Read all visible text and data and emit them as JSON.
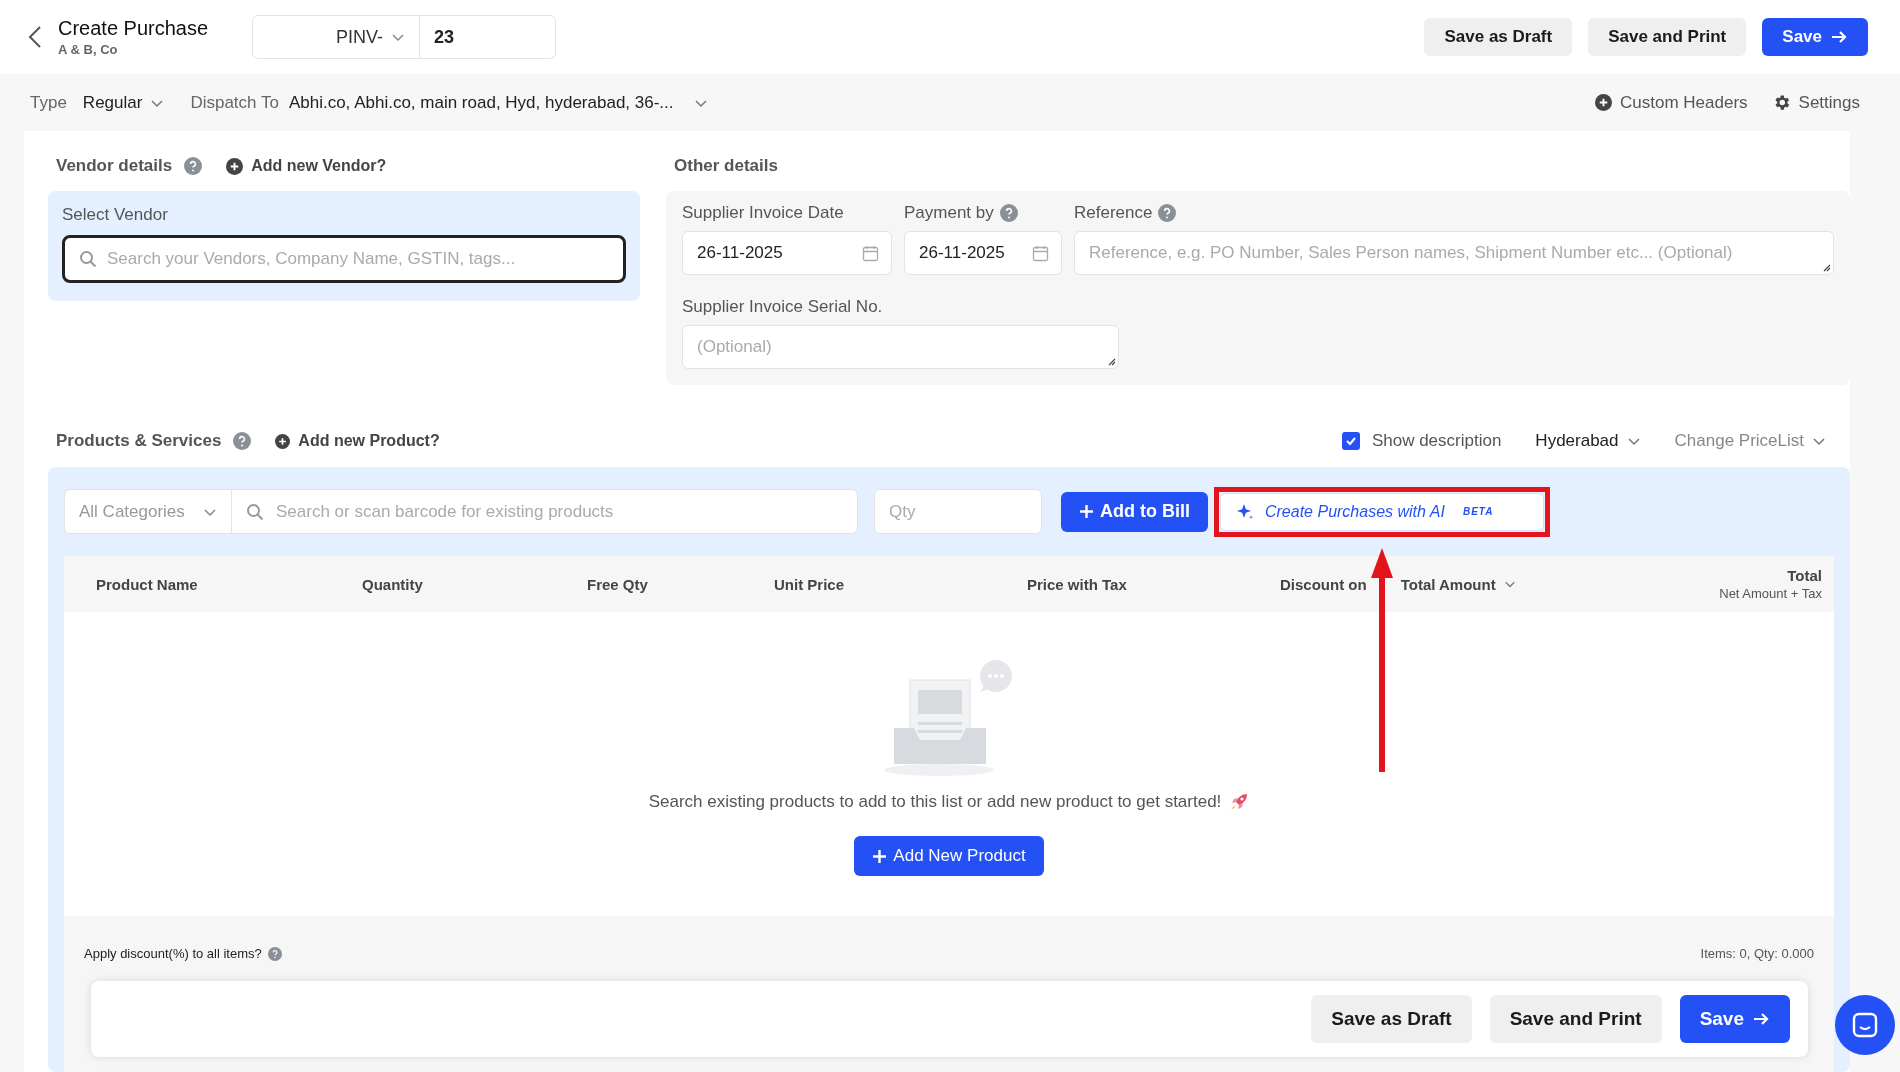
{
  "header": {
    "title": "Create Purchase",
    "subtitle": "A & B, Co",
    "prefix": "PINV-",
    "number": "23",
    "buttons": [
      {
        "label": "Save as Draft",
        "kind": "secondary"
      },
      {
        "label": "Save and Print",
        "kind": "secondary"
      },
      {
        "label": "Save",
        "kind": "primary"
      }
    ]
  },
  "subbar": {
    "type_label": "Type",
    "type_value": "Regular",
    "dispatch_label": "Dispatch To",
    "dispatch_value": "Abhi.co, Abhi.co, main road, Hyd, hyderabad, 36-...",
    "links": [
      {
        "label": "Custom Headers",
        "kind": "add"
      },
      {
        "label": "Settings",
        "kind": "settings"
      }
    ]
  },
  "vendor": {
    "heading": "Vendor details",
    "add_link": "Add new Vendor?",
    "field_label": "Select Vendor",
    "placeholder": "Search your Vendors, Company Name, GSTIN, tags..."
  },
  "other": {
    "heading": "Other details",
    "fields": [
      {
        "label": "Supplier Invoice Date",
        "kind": "date",
        "help": false,
        "value": "26-11-2025"
      },
      {
        "label": "Payment by",
        "kind": "date",
        "help": true,
        "value": "26-11-2025"
      },
      {
        "label": "Reference",
        "kind": "text",
        "help": true,
        "placeholder": "Reference, e.g. PO Number, Sales Person names, Shipment Number etc... (Optional)"
      },
      {
        "label": "Supplier Invoice Serial No.",
        "kind": "text",
        "help": false,
        "placeholder": "(Optional)"
      }
    ]
  },
  "products": {
    "heading": "Products & Services",
    "add_link": "Add new Product?",
    "show_description": {
      "label": "Show description",
      "checked": true
    },
    "location": "Hyderabad",
    "pricelist": "Change PriceList",
    "category": "All Categories",
    "search_placeholder": "Search or scan barcode for existing products",
    "qty_placeholder": "Qty",
    "add_button": "Add to Bill",
    "ai_button": {
      "label": "Create Purchases with AI",
      "badge": "BETA"
    },
    "columns": [
      {
        "label": "Product Name"
      },
      {
        "label": "Quantity"
      },
      {
        "label": "Free Qty"
      },
      {
        "label": "Unit Price"
      },
      {
        "label": "Price with Tax"
      },
      {
        "label": "Discount on",
        "dropdown": "Total Amount"
      },
      {
        "label": "Total",
        "sublabel": "Net Amount + Tax"
      }
    ],
    "empty_message": "Search existing products to add to this list or add new product to get started!",
    "add_new": "Add New Product",
    "discount_label": "Apply discount(%) to all items?",
    "summary": "Items: 0, Qty: 0.000"
  },
  "footer": {
    "buttons": [
      {
        "label": "Save as Draft",
        "kind": "secondary"
      },
      {
        "label": "Save and Print",
        "kind": "secondary"
      },
      {
        "label": "Save",
        "kind": "primary"
      }
    ]
  }
}
